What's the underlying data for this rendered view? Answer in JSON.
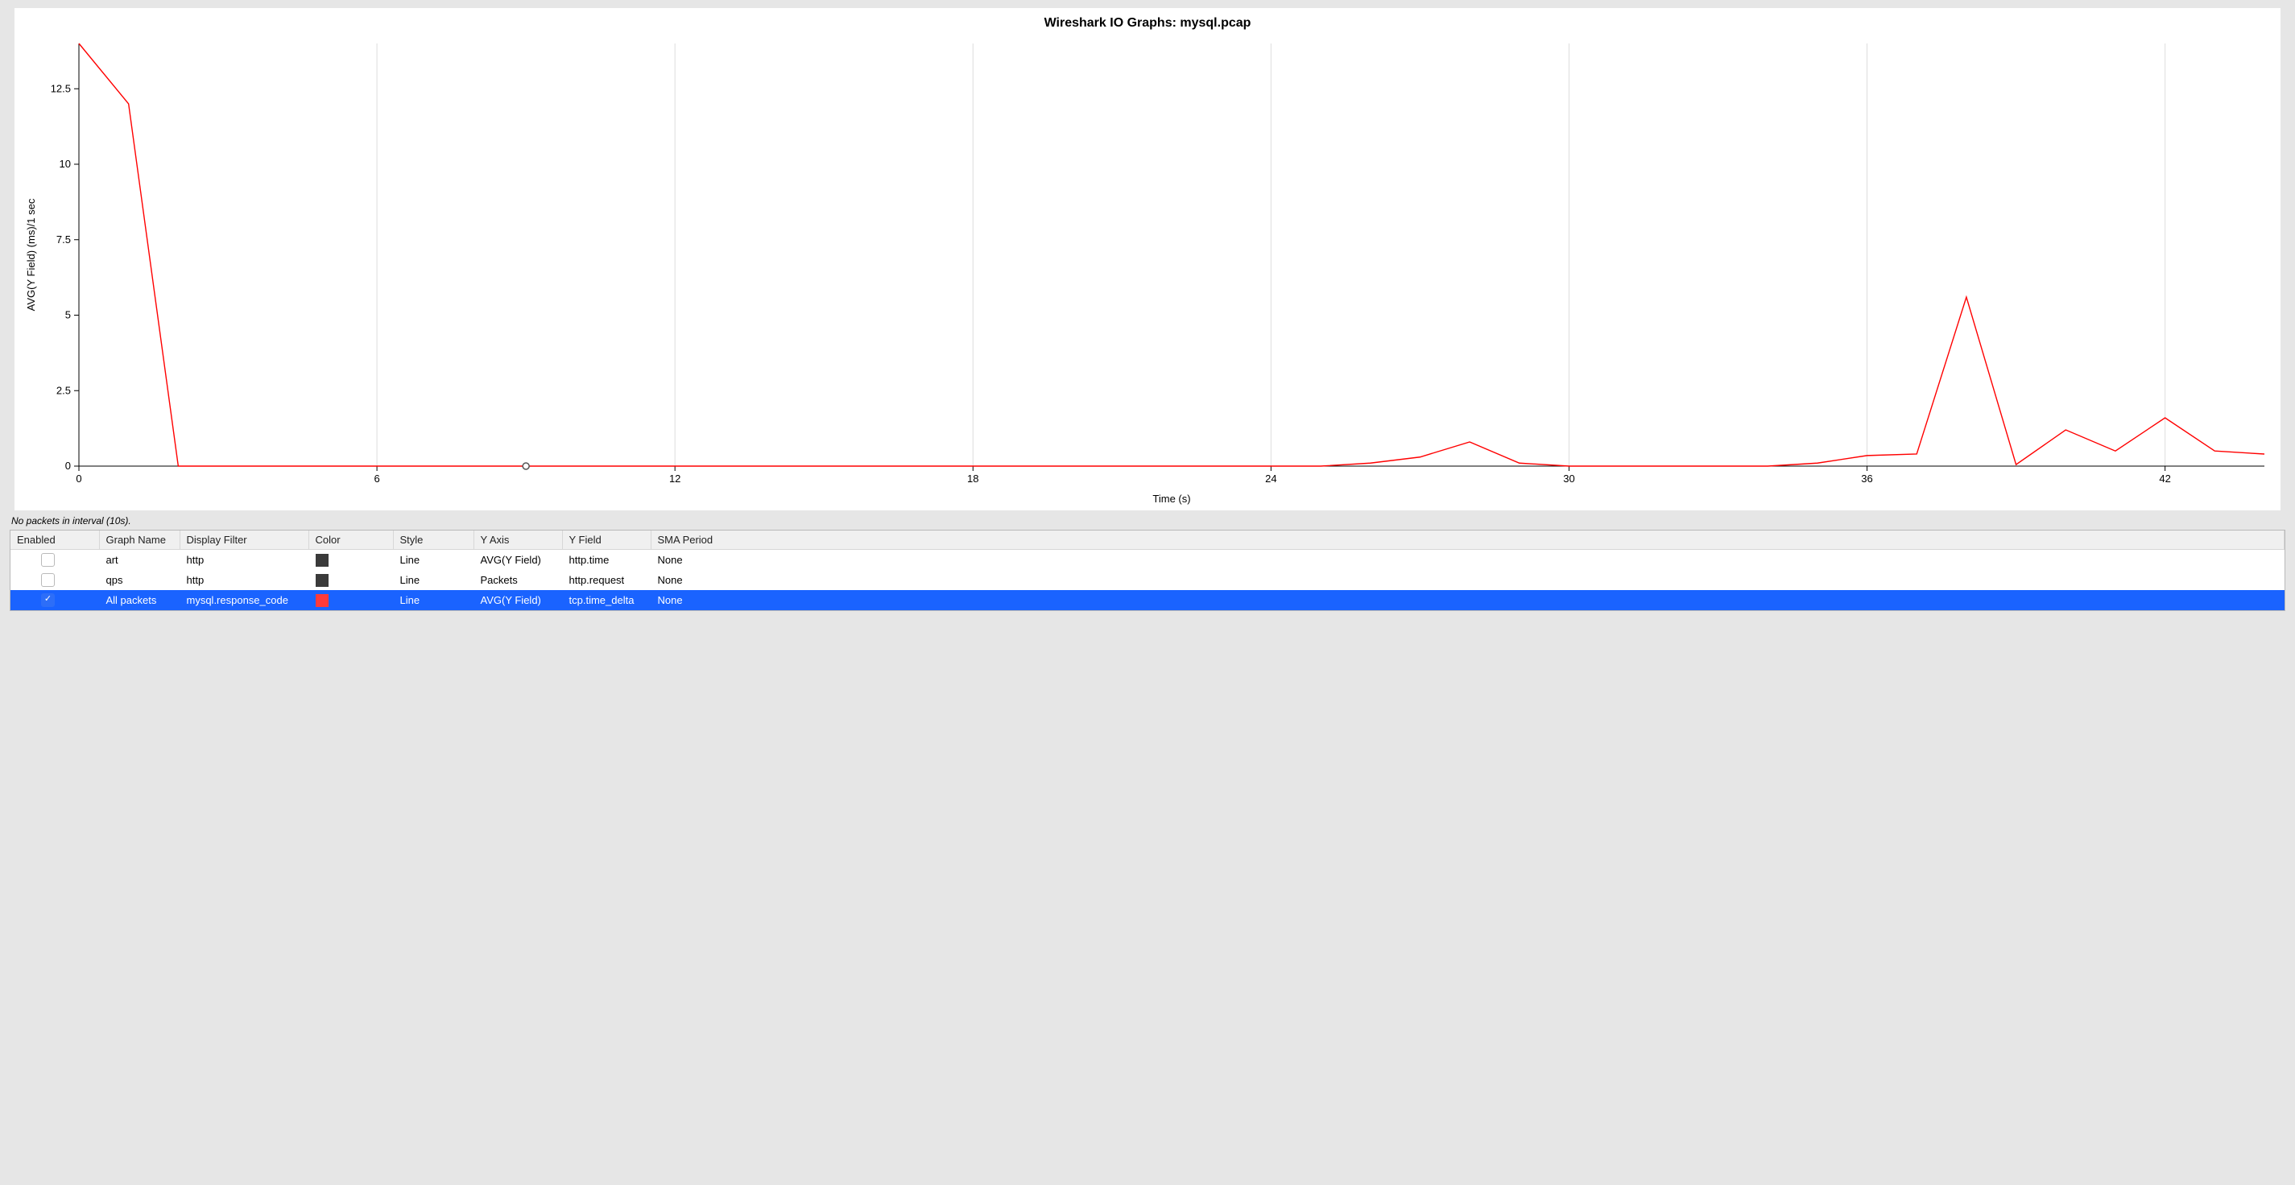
{
  "title": "Wireshark IO Graphs: mysql.pcap",
  "status": "No packets in interval (10s).",
  "axes": {
    "xlabel": "Time (s)",
    "ylabel": "AVG(Y Field) (ms)/1 sec"
  },
  "columns": {
    "enabled": "Enabled",
    "name": "Graph Name",
    "filter": "Display Filter",
    "color": "Color",
    "style": "Style",
    "yaxis": "Y Axis",
    "yfield": "Y Field",
    "sma": "SMA Period"
  },
  "rows": [
    {
      "enabled": false,
      "name": "art",
      "filter": "http",
      "color": "#3a3a3a",
      "style": "Line",
      "yaxis": "AVG(Y Field)",
      "yfield": "http.time",
      "sma": "None",
      "selected": false
    },
    {
      "enabled": false,
      "name": "qps",
      "filter": "http",
      "color": "#3a3a3a",
      "style": "Line",
      "yaxis": "Packets",
      "yfield": "http.request",
      "sma": "None",
      "selected": false
    },
    {
      "enabled": true,
      "name": "All packets",
      "filter": "mysql.response_code",
      "color": "#ff3a3a",
      "style": "Line",
      "yaxis": "AVG(Y Field)",
      "yfield": "tcp.time_delta",
      "sma": "None",
      "selected": true
    }
  ],
  "chart_data": {
    "type": "line",
    "title": "Wireshark IO Graphs: mysql.pcap",
    "xlabel": "Time (s)",
    "ylabel": "AVG(Y Field) (ms)/1 sec",
    "xlim": [
      0,
      44
    ],
    "ylim": [
      0,
      14
    ],
    "xticks": [
      0,
      6,
      12,
      18,
      24,
      30,
      36,
      42
    ],
    "yticks": [
      0,
      2.5,
      5,
      7.5,
      10,
      12.5
    ],
    "hover_point": {
      "x": 9,
      "y": 0
    },
    "series": [
      {
        "name": "All packets",
        "color": "#ff0000",
        "x": [
          0,
          1,
          2,
          3,
          4,
          5,
          6,
          7,
          8,
          9,
          10,
          11,
          12,
          13,
          14,
          15,
          16,
          17,
          18,
          19,
          20,
          21,
          22,
          23,
          24,
          25,
          26,
          27,
          28,
          29,
          30,
          31,
          32,
          33,
          34,
          35,
          36,
          37,
          38,
          39,
          40,
          41,
          42,
          43,
          44
        ],
        "values": [
          14.0,
          12.0,
          0,
          0,
          0,
          0,
          0,
          0,
          0,
          0,
          0,
          0,
          0,
          0,
          0,
          0,
          0,
          0,
          0,
          0,
          0,
          0,
          0,
          0,
          0,
          0,
          0.1,
          0.3,
          0.8,
          0.1,
          0,
          0,
          0,
          0,
          0,
          0.1,
          0.35,
          0.4,
          5.6,
          0.05,
          1.2,
          0.5,
          1.6,
          0.5,
          0.4
        ]
      }
    ]
  }
}
